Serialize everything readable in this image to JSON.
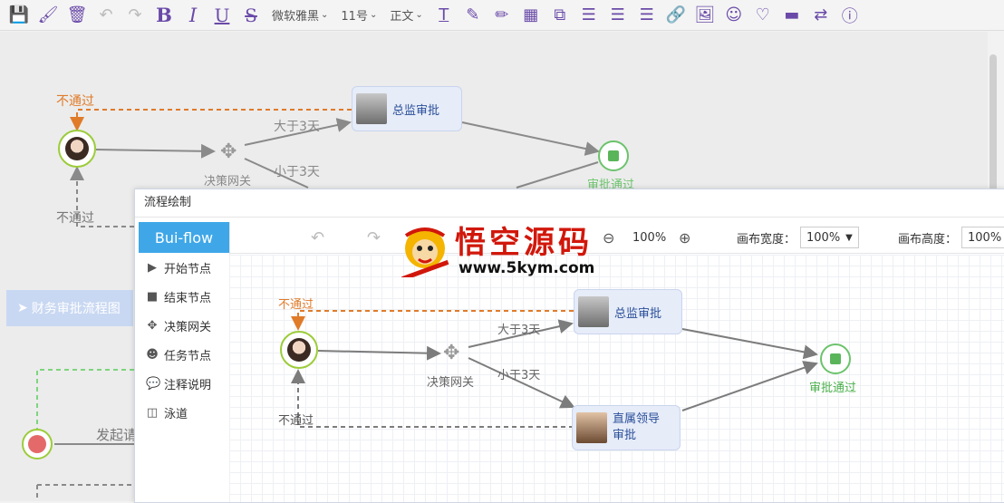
{
  "toolbar": {
    "font_family": "微软雅黑",
    "font_size": "11号",
    "paragraph": "正文",
    "bold_label": "B",
    "italic_label": "I",
    "underline_label": "U",
    "strike_label": "S",
    "icons": [
      "save-icon",
      "brush-icon",
      "trash-icon",
      "undo-icon",
      "redo-icon",
      "text-height-icon",
      "pencil-icon",
      "edit-icon",
      "table-icon",
      "copy-icon",
      "align-center-icon",
      "align-left-icon",
      "align-right-icon",
      "link-icon",
      "image-icon",
      "smile-icon",
      "heart-icon",
      "minus-icon",
      "shuffle-icon",
      "info-icon"
    ]
  },
  "background_flow": {
    "reject_top": "不通过",
    "gt3": "大于3天",
    "lt3": "小于3天",
    "gateway": "决策网关",
    "director": "总监审批",
    "approved": "审批通过",
    "reject_bottom": "不通过",
    "initiate": "发起请",
    "finance_button": "财务审批流程图"
  },
  "dialog": {
    "title": "流程绘制",
    "brand": "Bui-flow",
    "sidebar": [
      {
        "icon": "play-icon",
        "label": "开始节点"
      },
      {
        "icon": "stop-icon",
        "label": "结束节点"
      },
      {
        "icon": "move-icon",
        "label": "决策网关"
      },
      {
        "icon": "user-icon",
        "label": "任务节点"
      },
      {
        "icon": "comment-icon",
        "label": "注释说明"
      },
      {
        "icon": "columns-icon",
        "label": "泳道"
      }
    ],
    "zoom": "100%",
    "canvas_width_label": "画布宽度：",
    "canvas_width": "100%",
    "canvas_height_label": "画布高度：",
    "canvas_height": "100%",
    "flow": {
      "reject_top": "不通过",
      "gt3": "大于3天",
      "lt3": "小于3天",
      "gateway": "决策网关",
      "director": "总监审批",
      "leader_line1": "直属领导",
      "leader_line2": "审批",
      "approved": "审批通过",
      "reject_bottom": "不通过"
    }
  },
  "watermark": {
    "title": "悟空源码",
    "url": "www.5kym.com"
  },
  "colors": {
    "accent": "#3fa7e8",
    "toolbar_icon": "#6a4aa8",
    "reject": "#e07b2a",
    "start_border": "#9ccc3a",
    "end_green": "#5ab55a"
  }
}
